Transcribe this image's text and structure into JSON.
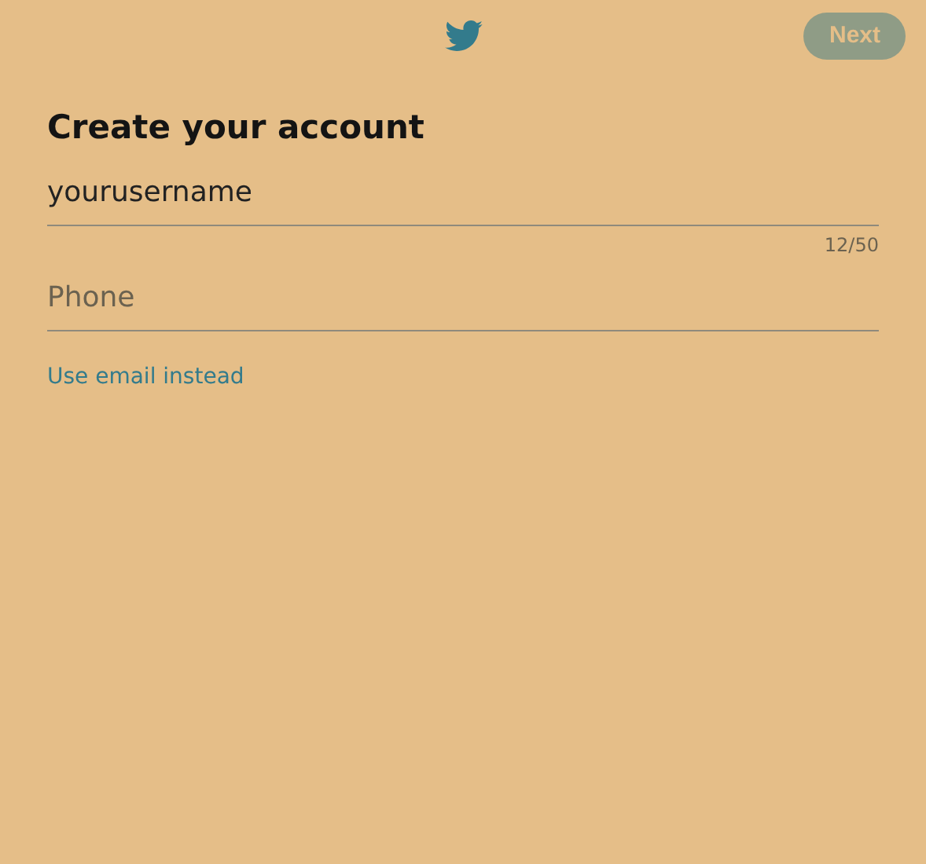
{
  "header": {
    "next_button": {
      "label": "Next",
      "disabled": true
    }
  },
  "title": "Create your account",
  "fields": [
    {
      "value": "yourusername",
      "counter": "12/50"
    },
    {
      "placeholder": "Phone"
    }
  ],
  "link": "Use email instead"
}
